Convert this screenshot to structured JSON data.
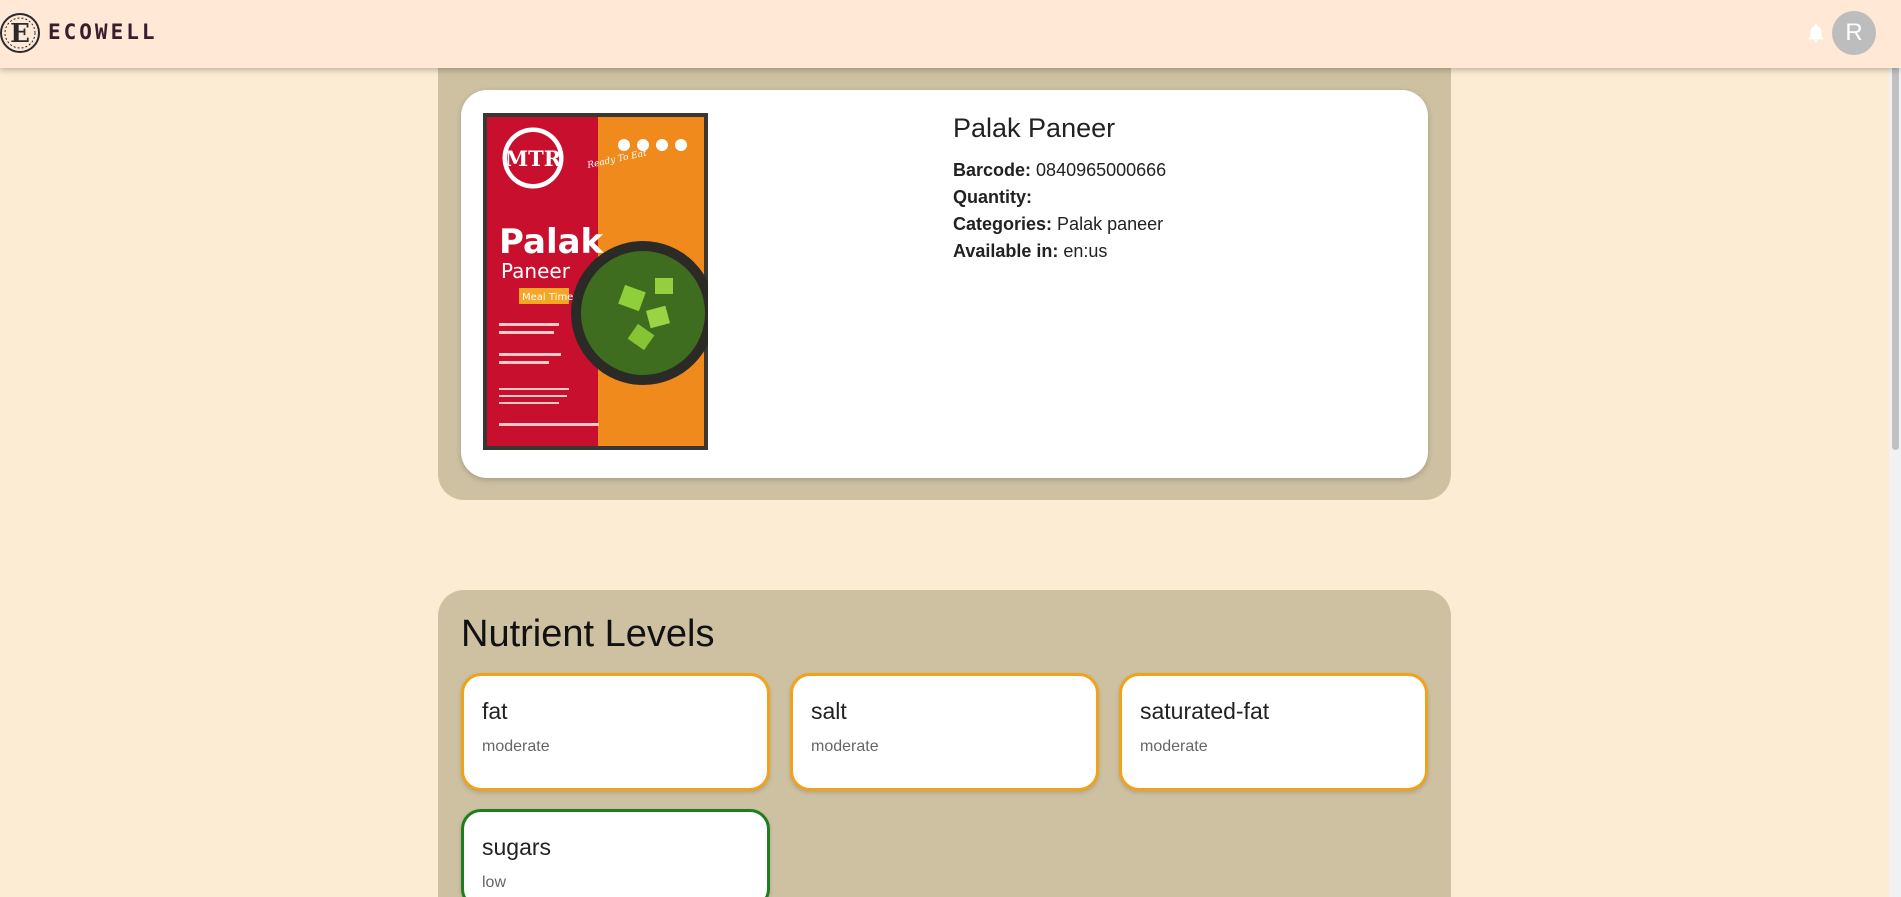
{
  "header": {
    "brand": "ECOWELL",
    "avatar_letter": "R"
  },
  "product": {
    "name": "Palak Paneer",
    "barcode_label": "Barcode:",
    "barcode": "0840965000666",
    "quantity_label": "Quantity:",
    "quantity": "",
    "categories_label": "Categories:",
    "categories": "Palak paneer",
    "available_label": "Available in:",
    "available": "en:us",
    "image": {
      "brand": "MTR",
      "tag": "Ready To Eat",
      "title_1": "Palak",
      "title_2": "Paneer",
      "badge": "Meal Time"
    }
  },
  "nutrients": {
    "title": "Nutrient Levels",
    "items": [
      {
        "name": "fat",
        "level": "moderate"
      },
      {
        "name": "salt",
        "level": "moderate"
      },
      {
        "name": "saturated-fat",
        "level": "moderate"
      },
      {
        "name": "sugars",
        "level": "low"
      }
    ]
  }
}
